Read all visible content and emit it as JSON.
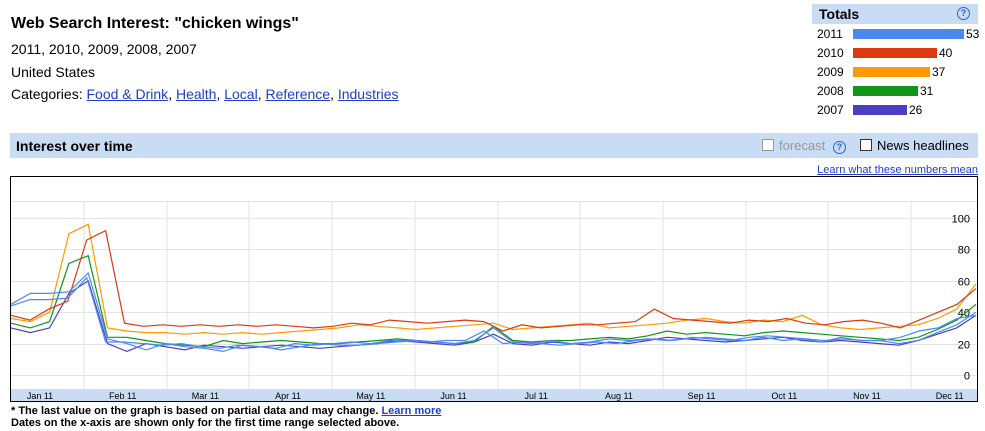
{
  "header": {
    "title": "Web Search Interest: \"chicken wings\"",
    "years": "2011, 2010, 2009, 2008, 2007",
    "region": "United States",
    "categories_label": "Categories:",
    "categories": [
      "Food & Drink",
      "Health",
      "Local",
      "Reference",
      "Industries"
    ]
  },
  "totals": {
    "title": "Totals",
    "help_icon": "?",
    "rows": [
      {
        "year": "2011",
        "value": 53,
        "color": "#4a8af0"
      },
      {
        "year": "2010",
        "value": 40,
        "color": "#dc3912"
      },
      {
        "year": "2009",
        "value": 37,
        "color": "#ff9900"
      },
      {
        "year": "2008",
        "value": 31,
        "color": "#109618"
      },
      {
        "year": "2007",
        "value": 26,
        "color": "#4b3ec5"
      }
    ]
  },
  "interest": {
    "title": "Interest over time",
    "forecast_label": "forecast",
    "forecast_help": "?",
    "news_label": "News headlines",
    "learn_link": "Learn what these numbers mean"
  },
  "chart_data": {
    "type": "line",
    "x": [
      "Jan 11",
      "Feb 11",
      "Mar 11",
      "Apr 11",
      "May 11",
      "Jun 11",
      "Jul 11",
      "Aug 11",
      "Sep 11",
      "Oct 11",
      "Nov 11",
      "Dec 11"
    ],
    "yticks": [
      0,
      20,
      40,
      60,
      80,
      100
    ],
    "ylim": [
      0,
      100
    ],
    "grid": true,
    "series": [
      {
        "name": "2011",
        "color": "#4a8af0",
        "values": [
          44,
          48,
          48,
          49,
          62,
          21,
          21,
          20,
          19,
          20,
          18,
          17,
          19,
          18,
          17,
          20,
          19,
          20,
          21,
          20,
          22,
          22,
          21,
          22,
          22,
          28,
          20,
          21,
          20,
          19,
          20,
          21,
          20,
          22,
          23,
          22,
          24,
          23,
          22,
          24,
          25,
          24,
          23,
          22,
          23,
          22,
          22,
          24,
          28,
          30,
          36,
          38
        ]
      },
      {
        "name": "2011",
        "color": "#4a8af0",
        "values": [
          45,
          52,
          52,
          53,
          65,
          23,
          20,
          16,
          20,
          18,
          17,
          15,
          19,
          18,
          16,
          18,
          20,
          19,
          19,
          20,
          21,
          22,
          21,
          20,
          22,
          30,
          21,
          20,
          22,
          20,
          21,
          23,
          22,
          23,
          22,
          23,
          24,
          23,
          22,
          24,
          22,
          23,
          21,
          24,
          22,
          22,
          20,
          22,
          27,
          32,
          40
        ]
      },
      {
        "name": "2010",
        "color": "#dc3912",
        "values": [
          38,
          35,
          42,
          47,
          86,
          92,
          33,
          31,
          32,
          31,
          32,
          31,
          32,
          31,
          32,
          31,
          30,
          31,
          33,
          32,
          35,
          34,
          33,
          34,
          35,
          34,
          28,
          32,
          30,
          31,
          32,
          32,
          33,
          34,
          42,
          36,
          35,
          34,
          33,
          35,
          34,
          36,
          33,
          32,
          34,
          35,
          33,
          30,
          35,
          40,
          45,
          55
        ]
      },
      {
        "name": "2009",
        "color": "#ff9900",
        "values": [
          36,
          34,
          40,
          90,
          96,
          30,
          28,
          27,
          27,
          26,
          27,
          26,
          27,
          26,
          27,
          28,
          29,
          30,
          32,
          31,
          30,
          29,
          30,
          31,
          32,
          33,
          29,
          30,
          31,
          32,
          33,
          30,
          31,
          32,
          33,
          35,
          36,
          34,
          33,
          35,
          34,
          38,
          32,
          30,
          29,
          30,
          31,
          32,
          36,
          42,
          58
        ]
      },
      {
        "name": "2008",
        "color": "#109618",
        "values": [
          33,
          30,
          34,
          71,
          76,
          24,
          24,
          22,
          20,
          19,
          18,
          22,
          20,
          21,
          22,
          21,
          20,
          20,
          21,
          22,
          23,
          22,
          21,
          20,
          21,
          31,
          22,
          21,
          22,
          22,
          23,
          24,
          23,
          25,
          28,
          26,
          27,
          26,
          25,
          27,
          28,
          27,
          26,
          25,
          24,
          23,
          22,
          24,
          29,
          35,
          45
        ]
      },
      {
        "name": "2007",
        "color": "#4b3ec5",
        "values": [
          30,
          27,
          30,
          52,
          60,
          20,
          15,
          20,
          18,
          16,
          19,
          18,
          17,
          18,
          19,
          18,
          17,
          18,
          19,
          20,
          22,
          21,
          20,
          19,
          21,
          26,
          20,
          19,
          21,
          20,
          19,
          21,
          20,
          22,
          24,
          23,
          22,
          21,
          22,
          23,
          24,
          22,
          21,
          22,
          21,
          20,
          19,
          22,
          26,
          30,
          38
        ]
      }
    ]
  },
  "footer": {
    "note1": "* The last value on the graph is based on partial data and may change.",
    "learn_more": "Learn more",
    "note2": "Dates on the x-axis are shown only for the first time range selected above."
  }
}
